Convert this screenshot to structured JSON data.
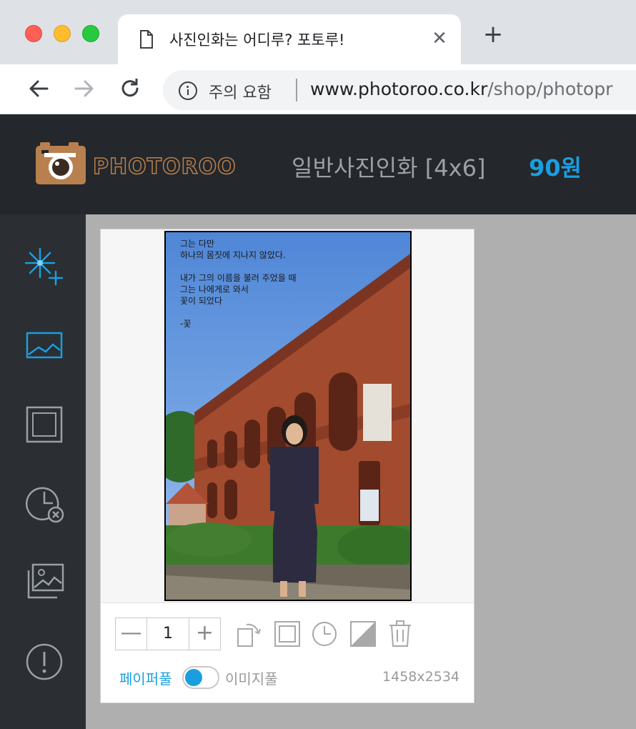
{
  "browser": {
    "tab_title": "사진인화는 어디루? 포토루!",
    "tab_close": "✕",
    "new_tab": "+",
    "security_label": "주의 요함",
    "url_host": "www.photoroo.co.kr",
    "url_path": "/shop/photopr"
  },
  "header": {
    "logo_text": "PHOTOROO",
    "product_name": "일반사진인화 [4x6]",
    "price": "90원"
  },
  "sidebar": {
    "icons": [
      "auto-enhance-icon",
      "image-icon",
      "frame-icon",
      "clock-x-icon",
      "gallery-icon",
      "alert-icon"
    ]
  },
  "photo": {
    "poem": "그는 다만\n하나의 몸짓에 지나지 않았다.\n\n내가 그의 이름을 불러 주었을 때\n그는 나에게로 와서\n꽃이 되었다\n\n-꽃"
  },
  "controls": {
    "qty_minus": "—",
    "quantity": "1",
    "qty_plus": "+",
    "paper_label": "페이퍼풀",
    "image_label": "이미지풀",
    "fill_mode": "paper",
    "dimensions": "1458x2534"
  },
  "colors": {
    "accent": "#1a9ee0",
    "header_bg": "#24272b",
    "sidebar_bg": "#2b2e33",
    "logo_brown": "#b8804e"
  }
}
